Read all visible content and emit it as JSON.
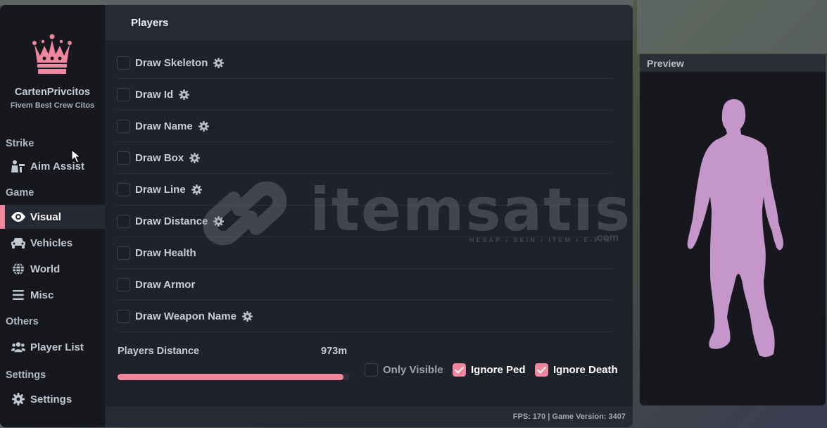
{
  "colors": {
    "accent": "#f0869e",
    "sidebar_bg": "#16181e",
    "panel_bg": "#20222b",
    "header_bg": "#272a35",
    "silhouette": "#c596c9"
  },
  "brand": {
    "logo_icon": "crown-icon",
    "name": "CartenPrivcitos",
    "tagline": "Fivem Best Crew Citos"
  },
  "sidebar": {
    "sections": [
      {
        "label": "Strike",
        "items": [
          {
            "label": "Aim Assist",
            "icon": "aim-assist-icon",
            "active": false
          }
        ]
      },
      {
        "label": "Game",
        "items": [
          {
            "label": "Visual",
            "icon": "eye-icon",
            "active": true
          },
          {
            "label": "Vehicles",
            "icon": "car-icon",
            "active": false
          },
          {
            "label": "World",
            "icon": "globe-icon",
            "active": false
          },
          {
            "label": "Misc",
            "icon": "menu-icon",
            "active": false
          }
        ]
      },
      {
        "label": "Others",
        "items": [
          {
            "label": "Player List",
            "icon": "users-icon",
            "active": false
          }
        ]
      },
      {
        "label": "Settings",
        "items": [
          {
            "label": "Settings",
            "icon": "gear-icon",
            "active": false
          }
        ]
      }
    ]
  },
  "main": {
    "title": "Players",
    "options": [
      {
        "label": "Draw Skeleton",
        "checked": false,
        "has_settings": true
      },
      {
        "label": "Draw Id",
        "checked": false,
        "has_settings": true
      },
      {
        "label": "Draw Name",
        "checked": false,
        "has_settings": true
      },
      {
        "label": "Draw Box",
        "checked": false,
        "has_settings": true
      },
      {
        "label": "Draw Line",
        "checked": false,
        "has_settings": true
      },
      {
        "label": "Draw Distance",
        "checked": false,
        "has_settings": true
      },
      {
        "label": "Draw Health",
        "checked": false,
        "has_settings": false
      },
      {
        "label": "Draw Armor",
        "checked": false,
        "has_settings": false
      },
      {
        "label": "Draw Weapon Name",
        "checked": false,
        "has_settings": true
      }
    ],
    "distance": {
      "label": "Players Distance",
      "value_text": "973m",
      "fill_fraction": 0.973
    },
    "toggles": [
      {
        "label": "Only Visible",
        "checked": false
      },
      {
        "label": "Ignore Ped",
        "checked": true
      },
      {
        "label": "Ignore Death",
        "checked": true
      }
    ]
  },
  "footer": {
    "status": "FPS: 170 | Game Version: 3407"
  },
  "preview": {
    "title": "Preview"
  },
  "watermark": {
    "text": "itemsatıs",
    "sub": "HESAP / SKIN / ITEM / E-PIN",
    "suffix": ".com"
  }
}
